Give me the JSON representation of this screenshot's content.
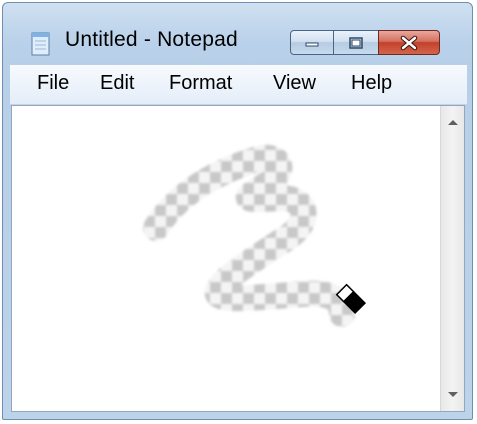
{
  "window": {
    "title": "Untitled - Notepad",
    "icon": "notepad-icon"
  },
  "title_buttons": {
    "minimize_icon": "minimize-icon",
    "maximize_icon": "maximize-icon",
    "close_icon": "close-icon"
  },
  "menu": {
    "items": [
      "File",
      "Edit",
      "Format",
      "View",
      "Help"
    ]
  },
  "canvas": {
    "content": "erased-transparent-stroke",
    "tool_icon": "eraser-icon"
  },
  "colors": {
    "titlebar": "#b9d1ea",
    "close_button": "#c2412c",
    "checker_dark": "#c8c8c8",
    "checker_light": "#f4f4f4"
  }
}
